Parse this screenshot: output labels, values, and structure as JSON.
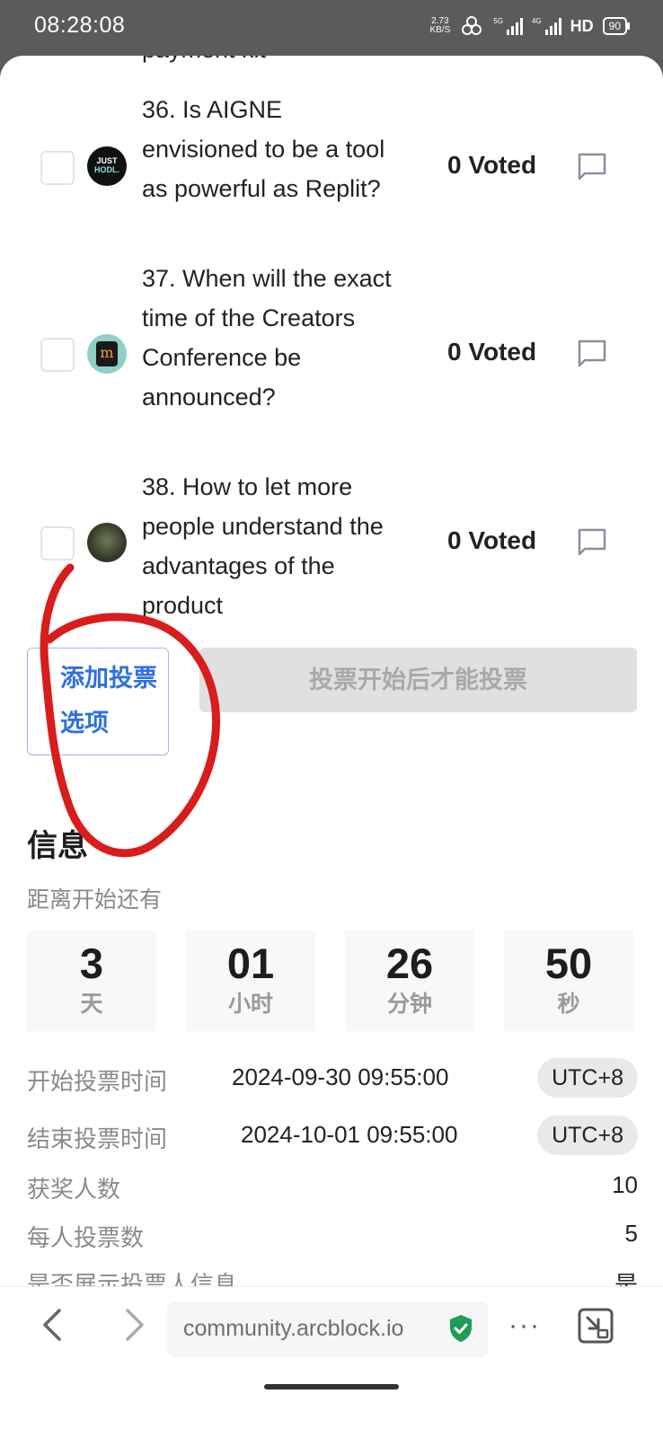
{
  "status_bar": {
    "time": "08:28:08",
    "net_speed_value": "2.73",
    "net_speed_unit": "KB/S",
    "signal1_label": "5G",
    "signal2_label": "4G",
    "hd_label": "HD",
    "battery": "90"
  },
  "options": {
    "cut_text": "payment kit",
    "items": [
      {
        "title": "36. Is AIGNE envisioned to be a tool as powerful as Replit?",
        "votes": "0 Voted",
        "avatar_text_line1": "JUST",
        "avatar_text_line2": "HODL."
      },
      {
        "title": "37. When will the exact time of the Creators Conference be announced?",
        "votes": "0 Voted",
        "avatar_text": "m"
      },
      {
        "title": "38. How to let more people understand the advantages of the product",
        "votes": "0 Voted"
      }
    ]
  },
  "actions": {
    "add_option_label": "添加投票选项",
    "vote_label": "投票开始后才能投票"
  },
  "info": {
    "title": "信息",
    "countdown_label": "距离开始还有",
    "countdown": [
      {
        "value": "3",
        "unit": "天"
      },
      {
        "value": "01",
        "unit": "小时"
      },
      {
        "value": "26",
        "unit": "分钟"
      },
      {
        "value": "50",
        "unit": "秒"
      }
    ],
    "start_label": "开始投票时间",
    "start_value": "2024-09-30 09:55:00",
    "start_tz": "UTC+8",
    "end_label": "结束投票时间",
    "end_value": "2024-10-01 09:55:00",
    "end_tz": "UTC+8",
    "winners_label": "获奖人数",
    "winners_value": "10",
    "votes_per_person_label": "每人投票数",
    "votes_per_person_value": "5",
    "show_voter_label": "是否展示投票人信息",
    "show_voter_value": "是"
  },
  "browser": {
    "url": "community.arcblock.io",
    "more_label": "···"
  },
  "colors": {
    "accent_blue": "#2f6fe0",
    "annotation_red": "#d91c1c",
    "secure_green": "#1f9d55"
  }
}
